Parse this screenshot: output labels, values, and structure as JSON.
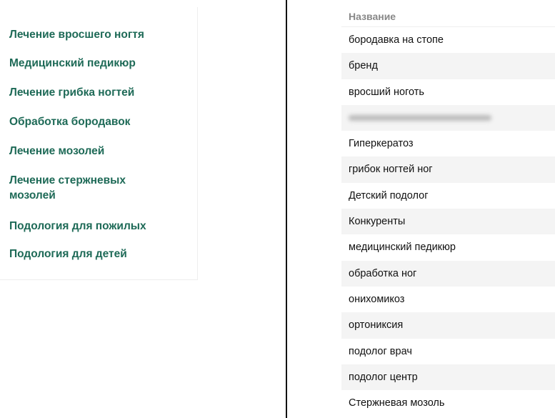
{
  "menu": {
    "items": [
      "Лечение вросшего ногтя",
      "Медицинский педикюр",
      "Лечение грибка ногтей",
      "Обработка бородавок",
      "Лечение мозолей",
      "Лечение стержневых мозолей",
      "Подология для пожилых",
      "Подология для детей"
    ]
  },
  "table": {
    "header": "Название",
    "rows": [
      "бородавка на стопе",
      "бренд",
      "вросший ноготь",
      "",
      "Гиперкератоз",
      "грибок ногтей ног",
      "Детский подолог",
      "Конкуренты",
      "медицинский педикюр",
      "обработка ног",
      "онихомикоз",
      "ортониксия",
      "подолог врач",
      "подолог центр",
      "Стержневая мозоль"
    ]
  }
}
